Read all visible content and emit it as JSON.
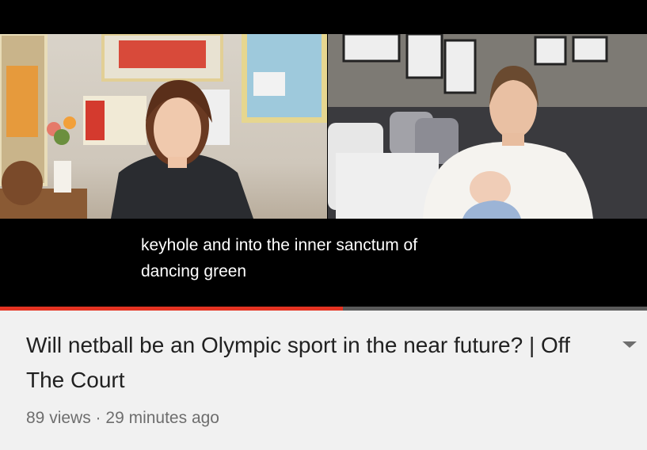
{
  "video": {
    "captions": [
      "keyhole and into the inner sanctum of",
      "dancing green"
    ],
    "progress_percent": 53
  },
  "details": {
    "title": "Will netball be an Olympic sport in the near future? | Off The Court",
    "views": "89 views",
    "separator": "·",
    "age": "29 minutes ago",
    "expand_icon": "chevron-down-icon"
  },
  "colors": {
    "progress": "#e53322",
    "title": "#212121",
    "meta": "#6e6e6e",
    "background": "#f1f1f1"
  }
}
